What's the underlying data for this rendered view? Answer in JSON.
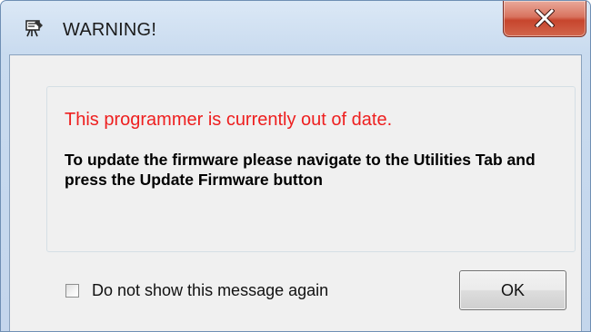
{
  "window": {
    "title": "WARNING!",
    "title_icon": "programmer-app-icon",
    "close_icon": "close-icon",
    "close_button_color": "#c7452d"
  },
  "message": {
    "status_text": "This programmer is currently out of date.",
    "status_color": "#ee1f1f",
    "instruction_text": "To update the firmware please navigate to the Utilities Tab and press the Update Firmware button"
  },
  "footer": {
    "checkbox_label": "Do not show this message again",
    "checkbox_checked": false,
    "ok_label": "OK"
  }
}
